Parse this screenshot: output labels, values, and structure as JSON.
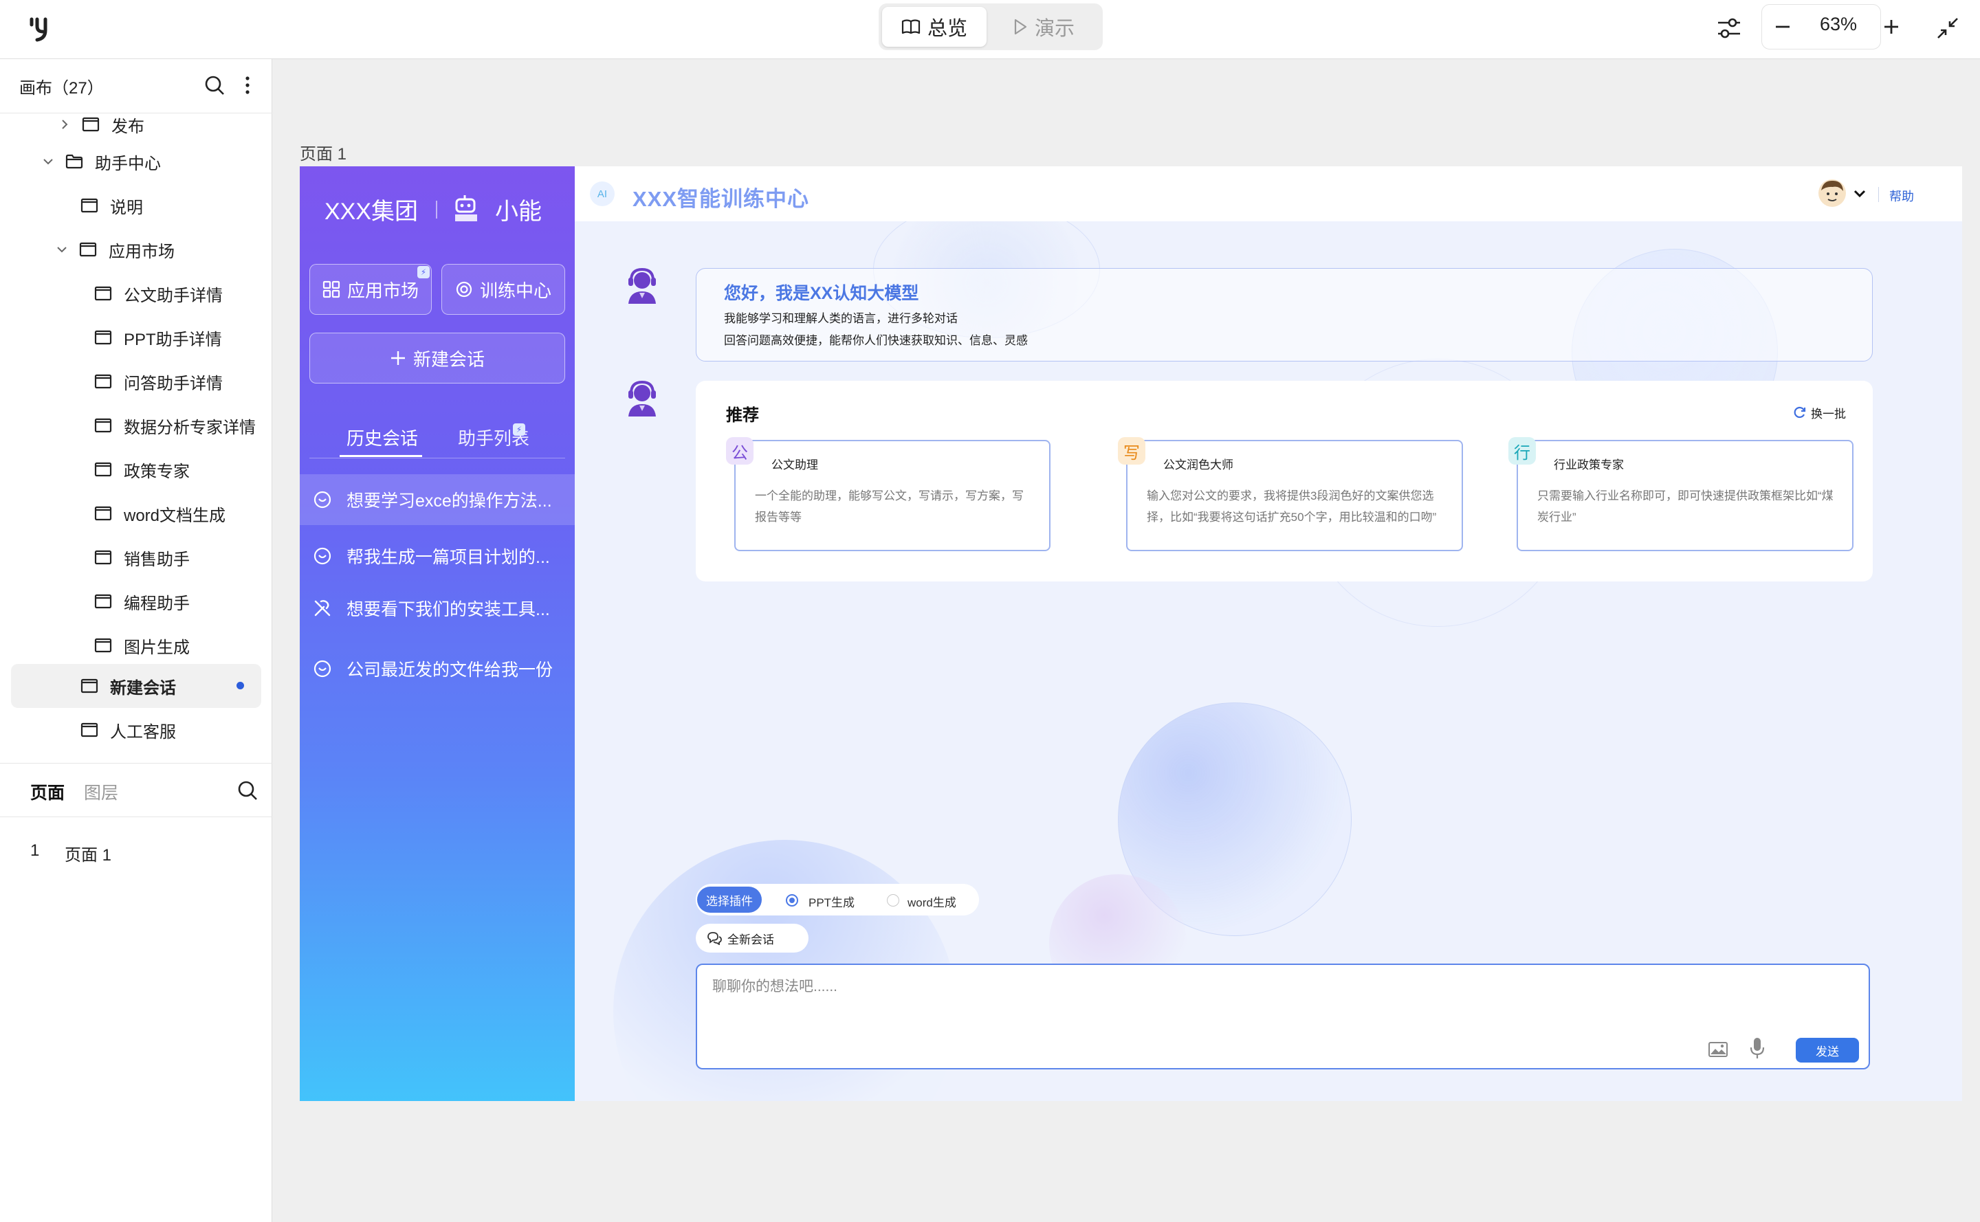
{
  "topbar": {
    "logo_icon": "brand-logo-icon",
    "modes": [
      {
        "label": "总览",
        "icon": "book-icon",
        "active": true
      },
      {
        "label": "演示",
        "icon": "play-icon",
        "active": false
      }
    ],
    "zoom": "63%"
  },
  "left_panel": {
    "canvas_header": "画布（27）",
    "tree": [
      {
        "label": "发布",
        "type": "page"
      },
      {
        "label": "助手中心",
        "type": "folder"
      },
      {
        "label": "说明",
        "type": "page"
      },
      {
        "label": "应用市场",
        "type": "page"
      },
      {
        "label": "公文助手详情",
        "type": "page"
      },
      {
        "label": "PPT助手详情",
        "type": "page"
      },
      {
        "label": "问答助手详情",
        "type": "page"
      },
      {
        "label": "数据分析专家详情",
        "type": "page"
      },
      {
        "label": "政策专家",
        "type": "page"
      },
      {
        "label": "word文档生成",
        "type": "page"
      },
      {
        "label": "销售助手",
        "type": "page"
      },
      {
        "label": "编程助手",
        "type": "page"
      },
      {
        "label": "图片生成",
        "type": "page"
      },
      {
        "label": "新建会话",
        "type": "page",
        "selected": true
      },
      {
        "label": "人工客服",
        "type": "page"
      }
    ],
    "tabs": {
      "pages": "页面",
      "layers": "图层"
    },
    "pages": [
      {
        "number": "1",
        "name": "页面 1"
      }
    ]
  },
  "canvas": {
    "page_label": "页面 1",
    "mockup": {
      "sidebar": {
        "brand": "XXX集团",
        "assistant_name": "小能",
        "app_market": "应用市场",
        "training_center": "训练中心",
        "new_chat": "新建会话",
        "tab_history": "历史会话",
        "tab_assistants": "助手列表",
        "history": [
          {
            "text": "想要学习exce的操作方法...",
            "icon": "chat-icon"
          },
          {
            "text": "帮我生成一篇项目计划的...",
            "icon": "chat-icon"
          },
          {
            "text": "想要看下我们的安装工具...",
            "icon": "tools-icon"
          },
          {
            "text": "公司最近发的文件给我一份",
            "icon": "chat-icon"
          }
        ]
      },
      "header": {
        "logo": "AI",
        "title": "XXX智能训练中心",
        "help": "帮助"
      },
      "greeting": {
        "title": "您好，我是XX认知大模型",
        "line1": "我能够学习和理解人类的语言，进行多轮对话",
        "line2": "回答问题高效便捷，能帮你人们快速获取知识、信息、灵感"
      },
      "recommend": {
        "title": "推荐",
        "refresh": "换一批",
        "cards": [
          {
            "badge": "公",
            "title": "公文助理",
            "desc": "一个全能的助理，能够写公文，写请示，写方案，写报告等等",
            "badge_color": "#7b4fd6",
            "badge_bg": "#ece2fb"
          },
          {
            "badge": "写",
            "title": "公文润色大师",
            "desc": "输入您对公文的要求，我将提供3段润色好的文案供您选择，比如“我要将这句话扩充50个字，用比较温和的口吻”",
            "badge_color": "#e88a1a",
            "badge_bg": "#fdebd1"
          },
          {
            "badge": "行",
            "title": "行业政策专家",
            "desc": "只需要输入行业名称即可，即可快速提供政策框架比如“煤炭行业”",
            "badge_color": "#1aa7b8",
            "badge_bg": "#d8f3f5"
          }
        ]
      },
      "composer": {
        "plugin_label": "选择插件",
        "options": [
          "PPT生成",
          "word生成"
        ],
        "selected_option": "PPT生成",
        "full_chat": "全新会话",
        "placeholder": "聊聊你的想法吧......",
        "send": "发送"
      }
    }
  }
}
